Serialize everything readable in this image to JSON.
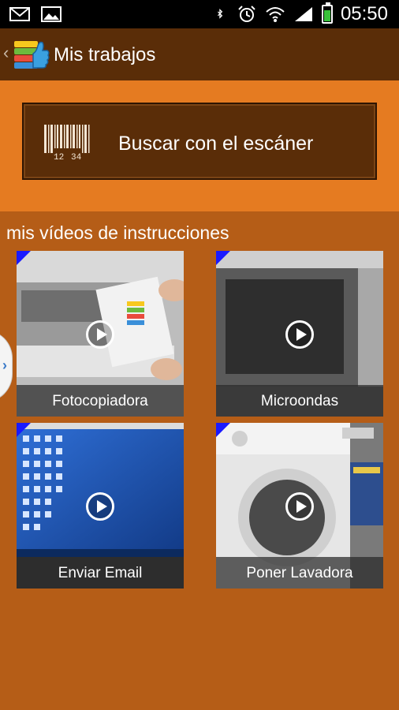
{
  "status_bar": {
    "time": "05:50",
    "left_icons": [
      "mail-icon",
      "image-icon"
    ],
    "right_icons": [
      "bluetooth-icon",
      "alarm-icon",
      "wifi-icon",
      "signal-icon",
      "battery-icon"
    ]
  },
  "action_bar": {
    "title": "Mis trabajos",
    "back_glyph": "‹"
  },
  "scanner": {
    "label": "Buscar con el escáner",
    "barcode_digits": [
      "12",
      "34"
    ]
  },
  "videos": {
    "section_title": "mis vídeos de instrucciones",
    "items": [
      {
        "caption": "Fotocopiadora"
      },
      {
        "caption": "Microondas"
      },
      {
        "caption": "Enviar Email"
      },
      {
        "caption": "Poner Lavadora"
      }
    ]
  },
  "side_tab": {
    "glyph": "›"
  },
  "colors": {
    "background": "#b55d17",
    "action_bar": "#5a2d08",
    "scan_panel": "#e57b21",
    "corner_marker": "#1a1aff"
  }
}
